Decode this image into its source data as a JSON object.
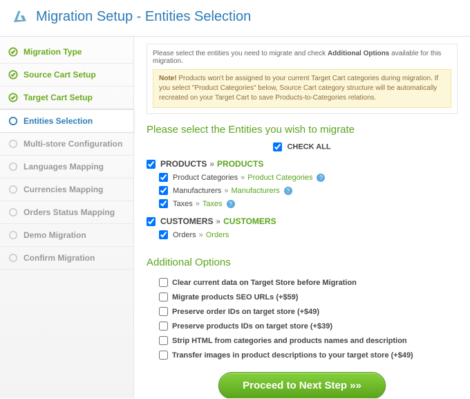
{
  "header": {
    "title": "Migration Setup - Entities Selection"
  },
  "sidebar": {
    "steps": [
      {
        "label": "Migration Type",
        "state": "done"
      },
      {
        "label": "Source Cart Setup",
        "state": "done"
      },
      {
        "label": "Target Cart Setup",
        "state": "done"
      },
      {
        "label": "Entities Selection",
        "state": "current"
      },
      {
        "label": "Multi-store Configuration",
        "state": "todo"
      },
      {
        "label": "Languages Mapping",
        "state": "todo"
      },
      {
        "label": "Currencies Mapping",
        "state": "todo"
      },
      {
        "label": "Orders Status Mapping",
        "state": "todo"
      },
      {
        "label": "Demo Migration",
        "state": "todo"
      },
      {
        "label": "Confirm Migration",
        "state": "todo"
      }
    ]
  },
  "info": {
    "instruction_pre": "Please select the entities you need to migrate and check ",
    "instruction_bold": "Additional Options",
    "instruction_post": " available for this migration.",
    "note_bold": "Note!",
    "note_text": " Products won't be assigned to your current Target Cart categories during migration. If you select \"Product Categories\" below, Source Cart category structure will be automatically recreated on your Target Cart to save Products-to-Categories relations."
  },
  "entities": {
    "heading": "Please select the Entities you wish to migrate",
    "check_all_label": "CHECK ALL",
    "groups": [
      {
        "source": "PRODUCTS",
        "target": "PRODUCTS",
        "checked": true,
        "children": [
          {
            "source": "Product Categories",
            "target": "Product Categories",
            "checked": true,
            "help": true
          },
          {
            "source": "Manufacturers",
            "target": "Manufacturers",
            "checked": true,
            "help": true
          },
          {
            "source": "Taxes",
            "target": "Taxes",
            "checked": true,
            "help": true
          }
        ]
      },
      {
        "source": "CUSTOMERS",
        "target": "CUSTOMERS",
        "checked": true,
        "children": [
          {
            "source": "Orders",
            "target": "Orders",
            "checked": true,
            "help": false
          }
        ]
      }
    ]
  },
  "options": {
    "heading": "Additional Options",
    "items": [
      {
        "label": "Clear current data on Target Store before Migration",
        "checked": false
      },
      {
        "label": "Migrate products SEO URLs (+$59)",
        "checked": false
      },
      {
        "label": "Preserve order IDs on target store (+$49)",
        "checked": false
      },
      {
        "label": "Preserve products IDs on target store (+$39)",
        "checked": false
      },
      {
        "label": "Strip HTML from categories and products names and description",
        "checked": false
      },
      {
        "label": "Transfer images in product descriptions to your target store (+$49)",
        "checked": false
      }
    ]
  },
  "proceed": {
    "label": "Proceed to Next Step »»"
  }
}
